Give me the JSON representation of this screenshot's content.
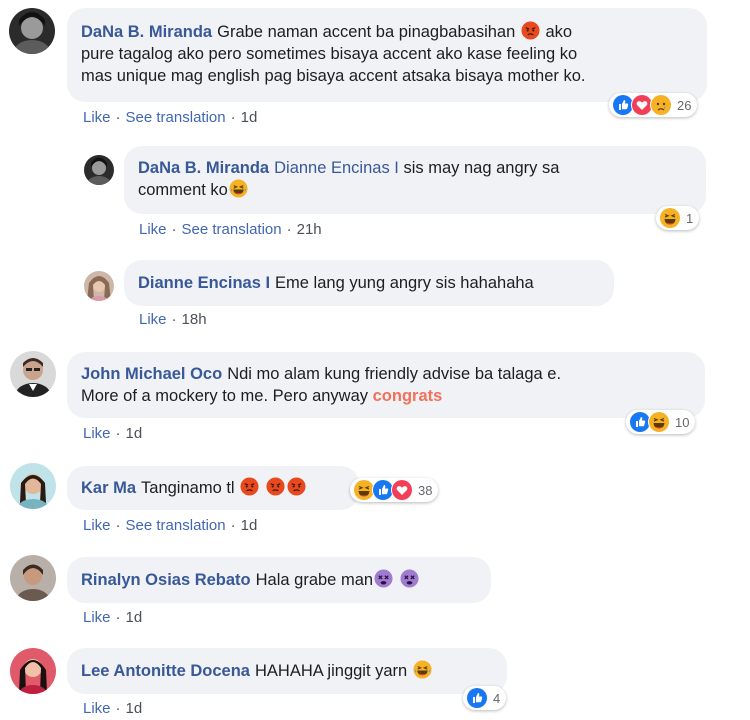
{
  "comments": [
    {
      "author": "DaNa B. Miranda",
      "lines": [
        "Grabe naman accent ba pinagbabasihan",
        "ako",
        "pure tagalog ako pero sometimes bisaya accent ako kase feeling ko",
        "mas unique mag english pag bisaya accent atsaka bisaya mother ko."
      ],
      "reaction_count": "26",
      "like_label": "Like",
      "translate_label": "See translation",
      "time": "1d"
    },
    {
      "author": "DaNa B. Miranda",
      "mention": "Dianne Encinas I",
      "lines": [
        "sis may nag angry sa",
        "comment ko"
      ],
      "reaction_count": "1",
      "like_label": "Like",
      "translate_label": "See translation",
      "time": "21h"
    },
    {
      "author": "Dianne Encinas I",
      "lines": [
        "Eme lang yung angry sis hahahaha"
      ],
      "like_label": "Like",
      "time": "18h"
    },
    {
      "author": "John Michael Oco",
      "lines": [
        "Ndi mo alam kung friendly advise ba talaga e.",
        "More of a mockery to me. Pero anyway",
        "congrats"
      ],
      "reaction_count": "10",
      "like_label": "Like",
      "time": "1d"
    },
    {
      "author": "Kar Ma",
      "lines": [
        "Tanginamo tl"
      ],
      "reaction_count": "38",
      "like_label": "Like",
      "translate_label": "See translation",
      "time": "1d"
    },
    {
      "author": "Rinalyn Osias Rebato",
      "lines": [
        "Hala grabe man"
      ],
      "like_label": "Like",
      "time": "1d"
    },
    {
      "author": "Lee Antonitte Docena",
      "lines": [
        "HAHAHA jinggit yarn"
      ],
      "reaction_count": "4",
      "like_label": "Like",
      "time": "1d"
    }
  ],
  "separator": "·",
  "colors": {
    "link_blue": "#385898",
    "action_blue": "#4267b2",
    "bubble_bg": "#f0f2f5",
    "mention_orange": "#f3705a"
  },
  "icons": {
    "angry": "angry-emoji",
    "laugh": "laughing-emoji",
    "like": "like-reaction-icon",
    "love": "love-reaction-icon",
    "sad": "sad-reaction-icon",
    "haha": "haha-reaction-icon",
    "dizzy": "dizzy-face-emoji"
  }
}
